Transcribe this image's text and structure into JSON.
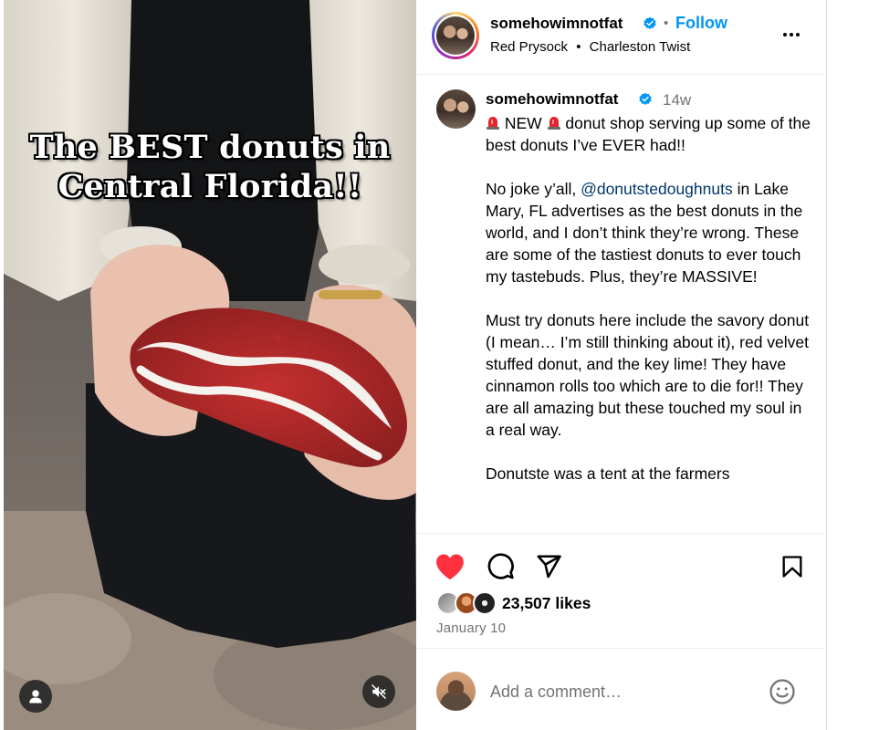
{
  "media": {
    "overlay_line1": "The BEST donuts in",
    "overlay_line2": "Central Florida!!",
    "user_icon": "user-icon",
    "mute_icon": "speaker-muted-icon"
  },
  "header": {
    "username": "somehowimnotfat",
    "separator": "•",
    "follow_label": "Follow",
    "audio_artist": "Red Prysock",
    "audio_separator": "•",
    "audio_track": "Charleston Twist",
    "more_icon": "more-horizontal-icon"
  },
  "post": {
    "username": "somehowimnotfat",
    "time_ago": "14w",
    "caption": {
      "line1_before": " NEW ",
      "line1_after": " donut shop serving up some of the best donuts I’ve EVER had!!",
      "p2_before": "No joke y’all, ",
      "mention": "@donutstedoughnuts",
      "p2_after": " in Lake Mary, FL advertises as the best donuts in the world, and I don’t think they’re wrong. These are some of the tastiest donuts to ever touch my tastebuds. Plus, they’re MASSIVE!",
      "p3": "Must try donuts here include the savory donut (I mean… I’m still thinking about it), red velvet stuffed donut, and the key lime! They have cinnamon rolls too which are to die for!! They are all amazing but these touched my soul in a real way.",
      "p4": "Donutste was a tent at the farmers"
    }
  },
  "actions": {
    "like_icon": "heart-filled-icon",
    "comment_icon": "comment-icon",
    "share_icon": "send-icon",
    "save_icon": "bookmark-icon",
    "likes": "23,507 likes",
    "date": "January 10",
    "like_color": "#ff3040",
    "link_color": "#0095f6"
  },
  "comment_bar": {
    "placeholder": "Add a comment…",
    "emoji_icon": "emoji-smile-icon"
  }
}
